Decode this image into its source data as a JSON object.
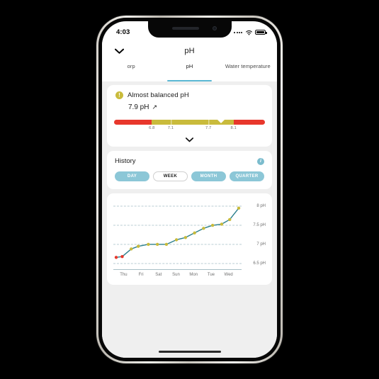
{
  "status_bar": {
    "time": "4:03",
    "signal_icon": "signal-dots-icon",
    "wifi_icon": "wifi-icon",
    "battery_icon": "battery-full-icon"
  },
  "nav": {
    "back_icon": "chevron-down-icon",
    "title": "pH"
  },
  "tabs": [
    {
      "label": "orp",
      "active": false
    },
    {
      "label": "pH",
      "active": true
    },
    {
      "label": "Water temperature",
      "active": false
    }
  ],
  "status_card": {
    "warning_icon": "exclamation-icon",
    "warning_glyph": "!",
    "title": "Almost balanced pH",
    "value": "7.9 pH",
    "trend_arrow": "↗",
    "expand_icon": "chevron-down-icon",
    "gauge": {
      "min": 6.2,
      "max": 8.6,
      "pointer_value": 7.9,
      "ticks": [
        {
          "label": "6.8",
          "value": 6.8
        },
        {
          "label": "7.1",
          "value": 7.1
        },
        {
          "label": "7.7",
          "value": 7.7
        },
        {
          "label": "8.1",
          "value": 8.1
        }
      ],
      "segments": [
        {
          "from": 6.2,
          "to": 6.8,
          "color": "#e8372c"
        },
        {
          "from": 6.8,
          "to": 7.1,
          "color": "#c9bb3c"
        },
        {
          "from": 7.1,
          "to": 7.7,
          "color": "#c9bb3c"
        },
        {
          "from": 7.7,
          "to": 8.1,
          "color": "#c9bb3c"
        },
        {
          "from": 8.1,
          "to": 8.6,
          "color": "#e8372c"
        }
      ]
    }
  },
  "history": {
    "title": "History",
    "info_icon": "info-icon",
    "info_glyph": "i",
    "ranges": [
      {
        "label": "DAY",
        "active": false
      },
      {
        "label": "WEEK",
        "active": true
      },
      {
        "label": "MONTH",
        "active": false
      },
      {
        "label": "QUARTER",
        "active": false
      }
    ]
  },
  "colors": {
    "accent": "#5bb8d4",
    "pill": "#8cc7d7",
    "warn": "#c9bb3c",
    "danger": "#e8372c",
    "line": "#2b7f8c",
    "grid": "#b9cdd3",
    "screen_bg": "#efefef"
  },
  "chart_data": {
    "type": "line",
    "title": "History",
    "xlabel": "",
    "ylabel": "pH",
    "ylim": [
      6.35,
      8.15
    ],
    "grid": true,
    "legend": "none",
    "y_ticks": [
      {
        "value": 8,
        "label": "8 pH"
      },
      {
        "value": 7.5,
        "label": "7.5 pH"
      },
      {
        "value": 7,
        "label": "7 pH"
      },
      {
        "value": 6.5,
        "label": "6.5 pH"
      }
    ],
    "categories": [
      "Thu",
      "Fri",
      "Sat",
      "Sun",
      "Mon",
      "Tue",
      "Wed"
    ],
    "x": [
      0,
      0.3,
      0.75,
      1.1,
      1.6,
      2.05,
      2.5,
      3.0,
      3.45,
      3.9,
      4.35,
      4.8,
      5.25,
      5.65,
      6.1
    ],
    "values": [
      6.66,
      6.68,
      6.88,
      6.95,
      7.0,
      7.0,
      7.0,
      7.12,
      7.18,
      7.3,
      7.42,
      7.5,
      7.53,
      7.65,
      7.95
    ],
    "point_colors": [
      "#e8372c",
      "#e8372c",
      "#c9bb3c",
      "#c9bb3c",
      "#c9bb3c",
      "#c9bb3c",
      "#c9bb3c",
      "#c9bb3c",
      "#c9bb3c",
      "#c9bb3c",
      "#c9bb3c",
      "#c9bb3c",
      "#c9bb3c",
      "#c9bb3c",
      "#c9bb3c"
    ],
    "line_color": "#2b7f8c"
  }
}
